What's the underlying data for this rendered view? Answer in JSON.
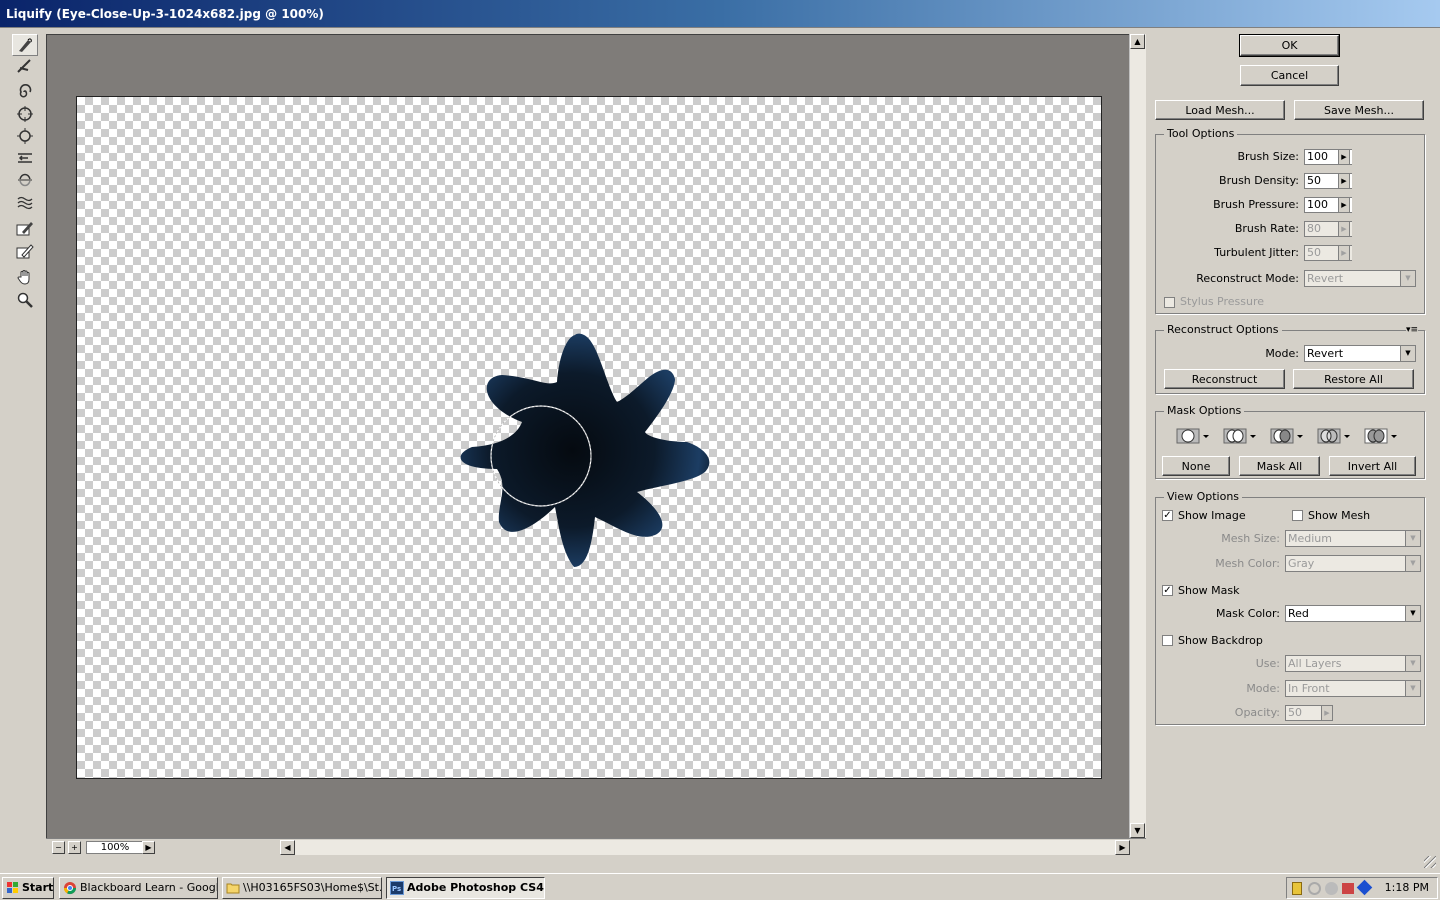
{
  "window": {
    "title": "Liquify (Eye-Close-Up-3-1024x682.jpg @ 100%)"
  },
  "tools": [
    {
      "name": "forward-warp-tool-icon",
      "active": true
    },
    {
      "name": "reconstruct-tool-icon"
    },
    {
      "name": "twirl-tool-icon"
    },
    {
      "name": "pucker-tool-icon"
    },
    {
      "name": "bloat-tool-icon"
    },
    {
      "name": "push-left-tool-icon"
    },
    {
      "name": "mirror-tool-icon"
    },
    {
      "name": "turbulence-tool-icon"
    },
    {
      "name": "freeze-mask-tool-icon"
    },
    {
      "name": "thaw-mask-tool-icon"
    },
    {
      "name": "hand-tool-icon"
    },
    {
      "name": "zoom-tool-icon"
    }
  ],
  "canvas": {
    "zoom": "100%"
  },
  "buttons": {
    "ok": "OK",
    "cancel": "Cancel",
    "load_mesh": "Load Mesh...",
    "save_mesh": "Save Mesh..."
  },
  "tool_options": {
    "title": "Tool Options",
    "brush_size": {
      "label": "Brush Size:",
      "value": "100"
    },
    "brush_density": {
      "label": "Brush Density:",
      "value": "50"
    },
    "brush_pressure": {
      "label": "Brush Pressure:",
      "value": "100"
    },
    "brush_rate": {
      "label": "Brush Rate:",
      "value": "80"
    },
    "turbulent_jitter": {
      "label": "Turbulent Jitter:",
      "value": "50"
    },
    "reconstruct_mode": {
      "label": "Reconstruct Mode:",
      "value": "Revert"
    },
    "stylus_pressure": {
      "label": "Stylus Pressure",
      "checked": false
    }
  },
  "reconstruct_options": {
    "title": "Reconstruct Options",
    "mode_label": "Mode:",
    "mode_value": "Revert",
    "reconstruct": "Reconstruct",
    "restore_all": "Restore All"
  },
  "mask_options": {
    "title": "Mask Options",
    "none": "None",
    "mask_all": "Mask All",
    "invert_all": "Invert All"
  },
  "view_options": {
    "title": "View Options",
    "show_image": {
      "label": "Show Image",
      "checked": true
    },
    "show_mesh": {
      "label": "Show Mesh",
      "checked": false
    },
    "mesh_size": {
      "label": "Mesh Size:",
      "value": "Medium"
    },
    "mesh_color": {
      "label": "Mesh Color:",
      "value": "Gray"
    },
    "show_mask": {
      "label": "Show Mask",
      "checked": true
    },
    "mask_color": {
      "label": "Mask Color:",
      "value": "Red"
    },
    "show_backdrop": {
      "label": "Show Backdrop",
      "checked": false
    },
    "use": {
      "label": "Use:",
      "value": "All Layers"
    },
    "mode": {
      "label": "Mode:",
      "value": "In Front"
    },
    "opacity": {
      "label": "Opacity:",
      "value": "50"
    }
  },
  "taskbar": {
    "start": "Start",
    "tasks": [
      {
        "label": "Blackboard Learn - Googl...",
        "icon": "chrome-icon"
      },
      {
        "label": "\\\\H03165FS03\\Home$\\St...",
        "icon": "folder-icon"
      },
      {
        "label": "Adobe Photoshop CS4...",
        "icon": "photoshop-icon",
        "active": true
      }
    ],
    "clock": "1:18 PM"
  }
}
